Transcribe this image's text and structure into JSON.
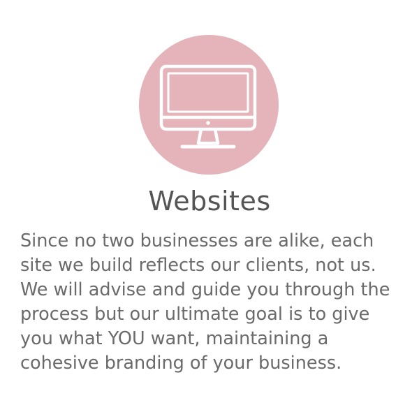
{
  "card": {
    "icon": "desktop-monitor-icon",
    "title": "Websites",
    "description": "Since no two businesses are alike, each\nsite we build reflects our clients, not us.\nWe will advise and guide you through the\nprocess but our ultimate goal is to give\nyou what YOU want, maintaining a\ncohesive branding of your business."
  },
  "colors": {
    "circle": "#e4b4ba",
    "icon_stroke": "#ffffff",
    "title_text": "#555555",
    "body_text": "#6a6a6a"
  }
}
